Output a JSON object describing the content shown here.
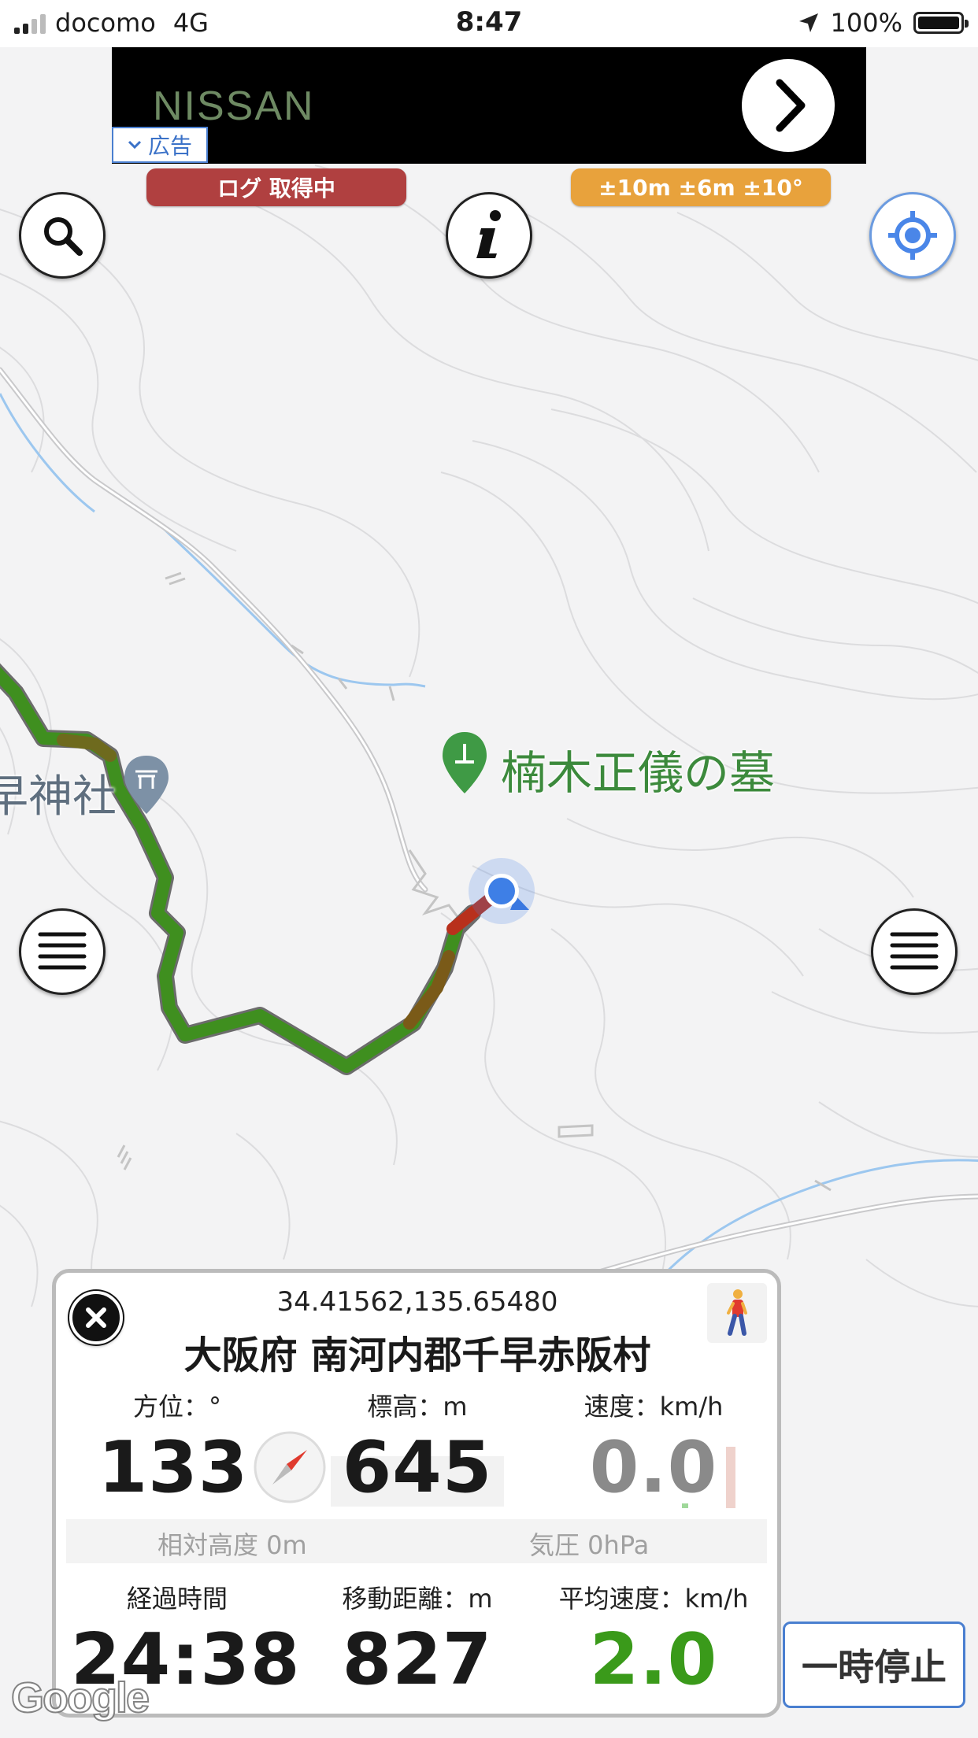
{
  "status_bar": {
    "carrier": "docomo",
    "network": "4G",
    "time": "8:47",
    "battery": "100%",
    "signal_bars": 2
  },
  "ad": {
    "brand": "NISSAN",
    "tag": "広告"
  },
  "badges": {
    "log_status": "ログ 取得中",
    "accuracy": "±10m ±6m ±10°"
  },
  "map": {
    "poi_label": "楠木正儀の墓",
    "shrine_label": "早神社"
  },
  "panel": {
    "coordinates": "34.41562,135.65480",
    "address": "大阪府 南河内郡千早赤阪村",
    "heading_label": "方位：°",
    "heading_value": "133",
    "altitude_label": "標高：m",
    "altitude_value": "645",
    "speed_label": "速度：km/h",
    "speed_value": "0.0",
    "relative_altitude": "相対高度 0m",
    "pressure": "気圧 0hPa",
    "elapsed_label": "経過時間",
    "elapsed_value": "24:38",
    "distance_label": "移動距離：m",
    "distance_value": "827",
    "avg_speed_label": "平均速度：km/h",
    "avg_speed_value": "2.0"
  },
  "buttons": {
    "pause": "一時停止"
  },
  "attribution": "Google",
  "colors": {
    "accent_blue": "#4a7fd0",
    "log_red": "#b04040",
    "accuracy_orange": "#e8a23c",
    "track_green": "#3f8f1f",
    "avg_speed_green": "#3a9a1a",
    "speed_grey": "#8a8a8a",
    "poi_green": "#3c8a3c"
  }
}
